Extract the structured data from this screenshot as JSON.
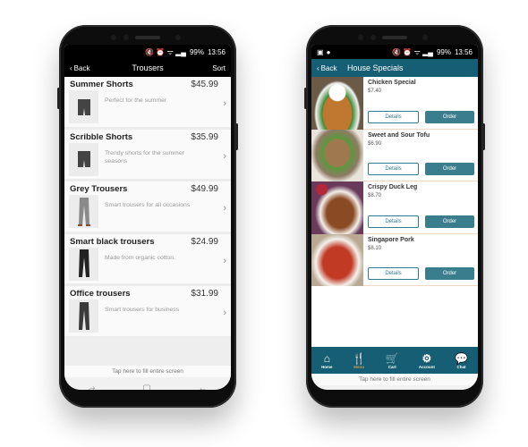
{
  "status_bar": {
    "icons": "🔇 ⏰ ᯤ ▂▄",
    "battery": "99%",
    "time": "13:56"
  },
  "left_phone": {
    "header": {
      "back_label": "Back",
      "title": "Trousers",
      "sort_label": "Sort"
    },
    "products": [
      {
        "name": "Summer Shorts",
        "price": "$45.99",
        "description": "Perfect for the summer",
        "thumb": "shorts"
      },
      {
        "name": "Scribble Shorts",
        "price": "$35.99",
        "description": "Trendy shorts for the summer seasons",
        "thumb": "shorts"
      },
      {
        "name": "Grey Trousers",
        "price": "$49.99",
        "description": "Smart trousers for all occasions",
        "thumb": "grey-trousers"
      },
      {
        "name": "Smart black trousers",
        "price": "$24.99",
        "description": "Made from organic cotton.",
        "thumb": "black-trousers"
      },
      {
        "name": "Office trousers",
        "price": "$31.99",
        "description": "Smart trousers for business",
        "thumb": "office-trousers"
      }
    ],
    "tap_hint": "Tap here to fill entire screen"
  },
  "right_phone": {
    "header": {
      "back_label": "Back",
      "title": "House Specials"
    },
    "menu_items": [
      {
        "name": "Chicken Special",
        "price": "$7.40",
        "details_label": "Details",
        "order_label": "Order"
      },
      {
        "name": "Sweet and Sour Tofu",
        "price": "$6.90",
        "details_label": "Details",
        "order_label": "Order"
      },
      {
        "name": "Crispy Duck Leg",
        "price": "$8.70",
        "details_label": "Details",
        "order_label": "Order"
      },
      {
        "name": "Singapore Pork",
        "price": "$8.10",
        "details_label": "Details",
        "order_label": "Order"
      }
    ],
    "tabs": [
      {
        "label": "Home",
        "icon": "home-icon",
        "glyph": "⌂",
        "active": false
      },
      {
        "label": "Menu",
        "icon": "cutlery-icon",
        "glyph": "🍴",
        "active": true
      },
      {
        "label": "Cart",
        "icon": "cart-icon",
        "glyph": "🛒",
        "active": false
      },
      {
        "label": "Account",
        "icon": "gear-icon",
        "glyph": "⚙",
        "active": false
      },
      {
        "label": "Chat",
        "icon": "chat-icon",
        "glyph": "💬",
        "active": false
      }
    ],
    "tap_hint": "Tap here to fill entire screen"
  },
  "colors": {
    "accent_teal": "#155e73",
    "button_teal": "#3a7d8c",
    "active_tab": "#c89a4a"
  },
  "nav_glyphs": {
    "recent": "⥄",
    "home": "▢",
    "back": "←"
  }
}
